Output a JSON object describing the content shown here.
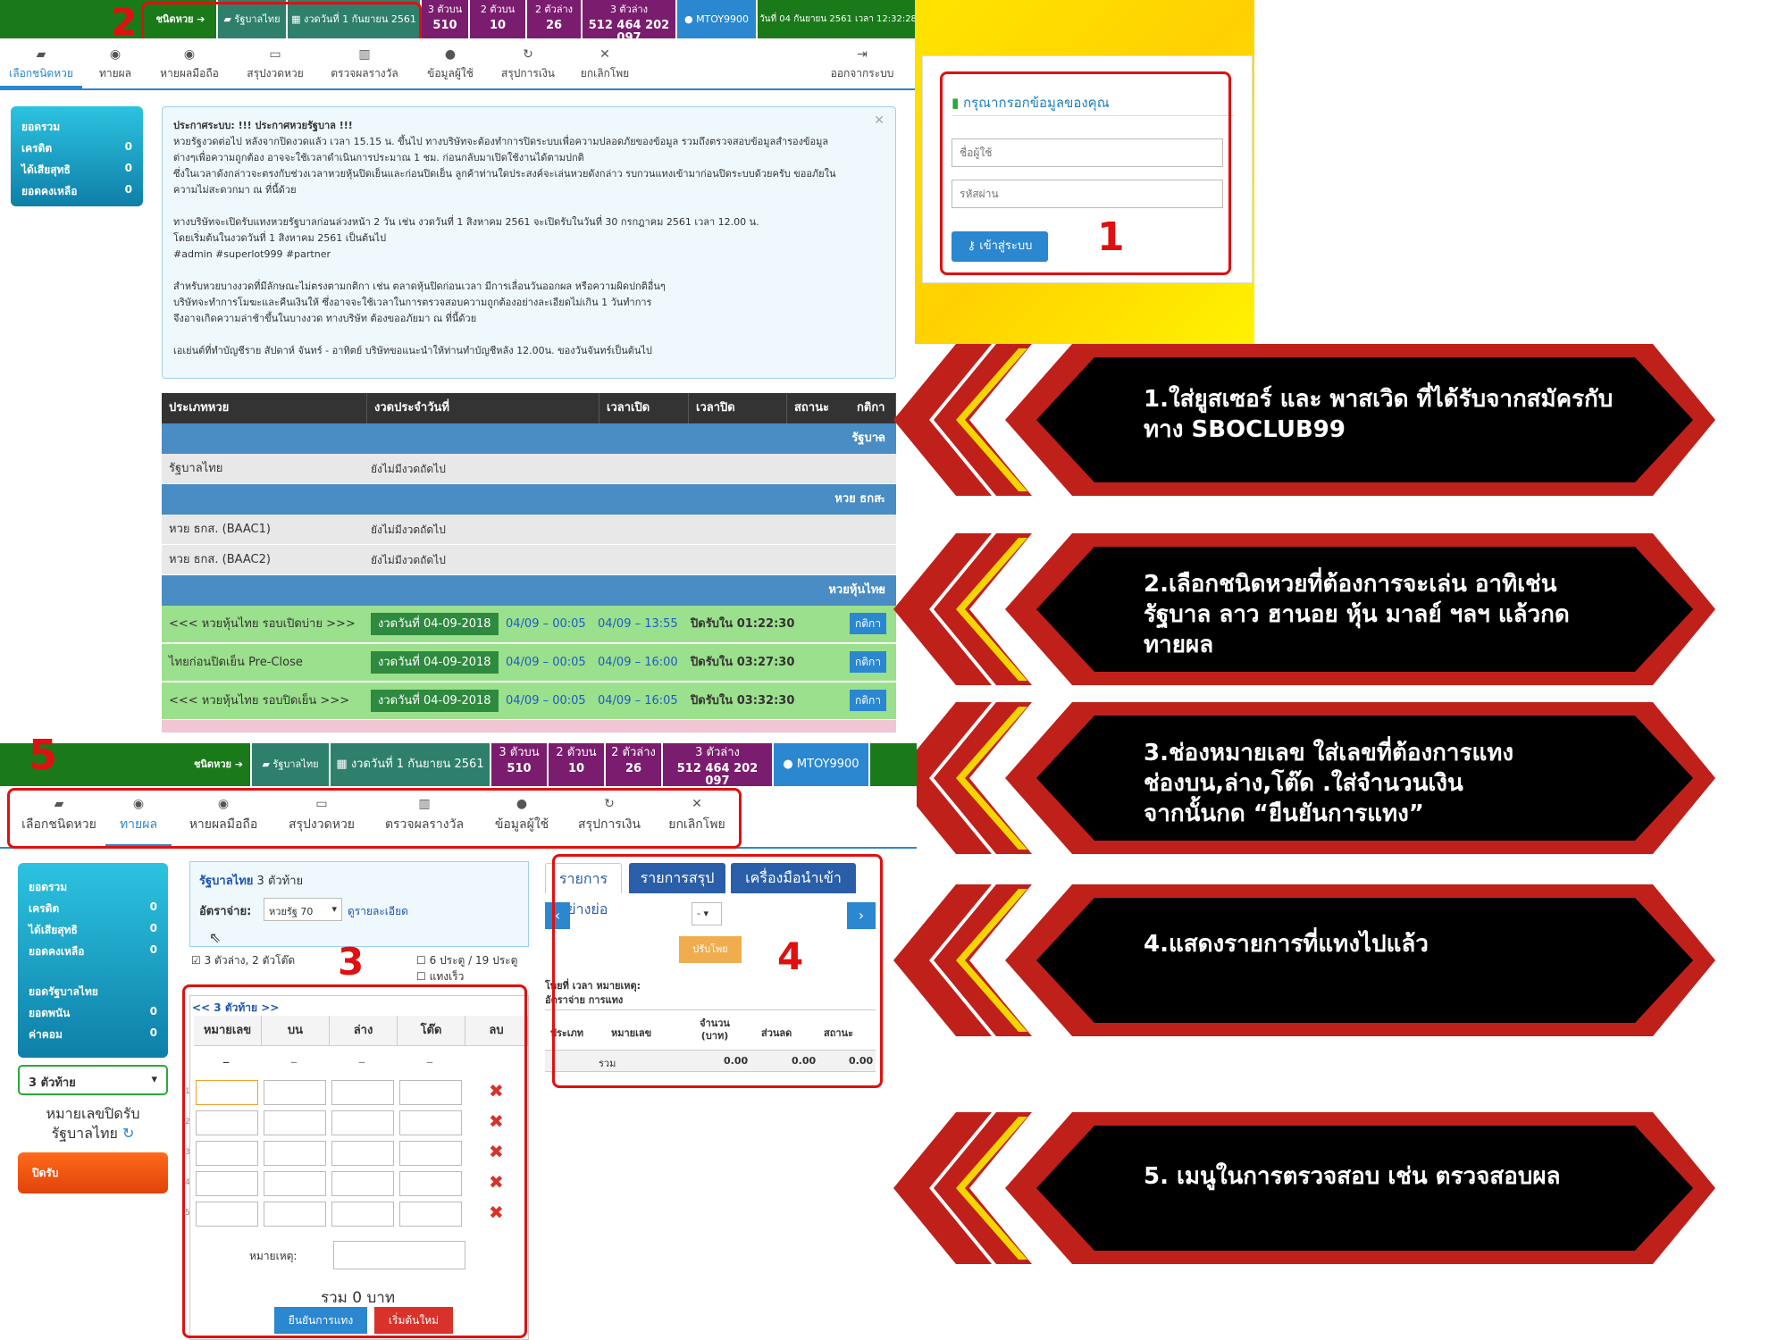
{
  "topbar": {
    "lottery_type": "ชนิดหวย ➔",
    "lottery_name": "รัฐบาลไทย",
    "draw": "งวดวันที่ 1 กันยายน 2561",
    "stats": [
      {
        "label": "3 ตัวบน",
        "value": "510"
      },
      {
        "label": "2 ตัวบน",
        "value": "10"
      },
      {
        "label": "2 ตัวล่าง",
        "value": "26"
      },
      {
        "label": "3 ตัวล่าง",
        "value": "512 464 202 097"
      }
    ],
    "user": "MTOY9900",
    "datetime": "วันที่ 04 กันยายน 2561 เวลา 12:32:28"
  },
  "nav": {
    "items": [
      "เลือกชนิดหวย",
      "ทายผล",
      "หายผลมือถือ",
      "สรุปงวดหวย",
      "ตรวจผลรางวัล",
      "ข้อมูลผู้ใช้",
      "สรุปการเงิน",
      "ยกเลิกโพย"
    ],
    "logout": "ออกจากระบบ"
  },
  "balance": {
    "title": "ยอดรวม",
    "rows": [
      {
        "label": "เครดิต",
        "value": "0"
      },
      {
        "label": "ได้เสียสุทธิ",
        "value": "0"
      },
      {
        "label": "ยอดคงเหลือ",
        "value": "0"
      }
    ]
  },
  "announce": {
    "lines": [
      "ประกาศระบบ: !!! ประกาศหวยรัฐบาล !!!",
      "หวยรัฐงวดต่อไป หลังจากปิดงวดแล้ว เวลา 15.15 น. ขึ้นไป ทางบริษัทจะต้องทำการปิดระบบเพื่อความปลอดภัยของข้อมูล รวมถึงตรวจสอบข้อมูลสำรองข้อมูล",
      "ต่างๆเพื่อความถูกต้อง อาจจะใช้เวลาดำเนินการประมาณ 1 ชม. ก่อนกลับมาเปิดใช้งานได้ตามปกติ",
      "ซึ่งในเวลาดังกล่าวจะตรงกับช่วงเวลาหวยหุ้นปิดเย็นและก่อนปิดเย็น ลูกค้าท่านใดประสงค์จะเล่นหวยดังกล่าว รบกวนแทงเข้ามาก่อนปิดระบบด้วยครับ ขออภัยใน",
      "ความไม่สะดวกมา ณ ที่นี้ด้วย",
      "",
      "ทางบริษัทจะเปิดรับแทงหวยรัฐบาลก่อนล่วงหน้า 2 วัน เช่น งวดวันที่ 1 สิงหาคม 2561 จะเปิดรับในวันที่ 30 กรกฎาคม 2561 เวลา 12.00 น.",
      "โดยเริ่มต้นในงวดวันที่ 1 สิงหาคม 2561 เป็นต้นไป",
      "#admin #superlot999 #partner",
      "",
      "สำหรับหวยบางงวดที่มีลักษณะไม่ตรงตามกติกา เช่น ตลาดหุ้นปิดก่อนเวลา มีการเลื่อนวันออกผล หรือความผิดปกติอื่นๆ",
      "บริษัทจะทำการโมฆะและคืนเงินให้ ซึ่งอาจจะใช้เวลาในการตรวจสอบความถูกต้องอย่างละเอียดไม่เกิน 1 วันทำการ",
      "จึงอาจเกิดความล่าช้าขึ้นในบางงวด ทางบริษัท ต้องขออภัยมา ณ ที่นี้ด้วย",
      "",
      "เอเย่นต์ที่ทำบัญชีราย สัปดาห์ จันทร์ - อาทิตย์ บริษัทขอแนะนำให้ท่านทำบัญชีหลัง 12.00น. ของวันจันทร์เป็นต้นไป"
    ]
  },
  "lotto_table": {
    "headers": [
      "ประเภทหวย",
      "งวดประจำวันที่",
      "เวลาเปิด",
      "เวลาปิด",
      "สถานะ",
      "กติกา"
    ],
    "groups": [
      {
        "name": "รัฐบาล",
        "rows": [
          {
            "name": "รัฐบาลไทย",
            "status": "ยังไม่มีงวดถัดไป"
          }
        ]
      },
      {
        "name": "หวย ธกส.",
        "rows": [
          {
            "name": "หวย ธกส. (BAAC1)",
            "status": "ยังไม่มีงวดถัดไป"
          },
          {
            "name": "หวย ธกส. (BAAC2)",
            "status": "ยังไม่มีงวดถัดไป"
          }
        ]
      },
      {
        "name": "หวยหุ้นไทย"
      }
    ],
    "stock_rows": [
      {
        "name": "<<< หวยหุ้นไทย รอบเปิดบ่าย >>>",
        "draw": "งวดวันที่ 04-09-2018",
        "open": "04/09 – 00:05",
        "close": "04/09 – 13:55",
        "status": "ปิดรับใน 01:22:30",
        "rule": "กติกา"
      },
      {
        "name": "ไทยก่อนปิดเย็น Pre-Close",
        "draw": "งวดวันที่ 04-09-2018",
        "open": "04/09 – 00:05",
        "close": "04/09 – 16:00",
        "status": "ปิดรับใน 03:27:30",
        "rule": "กติกา"
      },
      {
        "name": "<<< หวยหุ้นไทย รอบปิดเย็น >>>",
        "draw": "งวดวันที่ 04-09-2018",
        "open": "04/09 – 00:05",
        "close": "04/09 – 16:05",
        "status": "ปิดรับใน 03:32:30",
        "rule": "กติกา"
      }
    ]
  },
  "login": {
    "title": "กรุณากรอกข้อมูลของคุณ",
    "username_placeholder": "ชื่อผู้ใช้",
    "password_placeholder": "รหัสผ่าน",
    "submit": "เข้าสู่ระบบ"
  },
  "markers": [
    "1",
    "2",
    "3",
    "4",
    "5"
  ],
  "callouts": [
    "1.ใส่ยูสเซอร์ และ พาสเวิด ที่ได้รับจากสมัครกับ\nทาง SBOCLUB99",
    "2.เลือกชนิดหวยที่ต้องการจะเล่น อาทิเช่น\nรัฐบาล ลาว ฮานอย หุ้น มาลย์ ฯลฯ แล้วกด\nทายผล",
    "3.ช่องหมายเลข ใส่เลขที่ต้องการแทง\n  ช่องบน,ล่าง,โต๊ด .ใส่จำนวนเงิน\nจากนั้นกด “ยืนยันการแทง”",
    "4.แสดงรายการที่แทงไปแล้ว",
    "5. เมนูในการตรวจสอบ เช่น ตรวจสอบผล"
  ],
  "bet": {
    "header_title": "รัฐบาลไทย",
    "header_sub": "3 ตัวท้าย",
    "rate_label": "อัตราจ่าย:",
    "rate_value": "หวยรัฐ 70",
    "rate_link": "ดูรายละเอียด",
    "opt1": "3 ตัวล่าง, 2 ตัวโต๊ด",
    "opt2": "6 ประตู / 19 ประตู",
    "opt3": "แทงเร็ว",
    "link": "<< 3 ตัวท้าย >>",
    "cols": [
      "หมายเลข",
      "บน",
      "ล่าง",
      "โต๊ด",
      "ลบ"
    ],
    "dash": "–",
    "row_nums": [
      "1",
      "2",
      "3",
      "4",
      "5"
    ],
    "note_label": "หมายเหตุ:",
    "total": "รวม 0 บาท",
    "confirm": "ยืนยันการแทง",
    "reset": "เริ่มต้นใหม่"
  },
  "side2": {
    "title": "ยอดรวม",
    "rows": [
      {
        "label": "เครดิต",
        "value": "0"
      },
      {
        "label": "ได้เสียสุทธิ",
        "value": "0"
      },
      {
        "label": "ยอดคงเหลือ",
        "value": "0"
      }
    ],
    "title2": "ยอดรัฐบาลไทย",
    "rows2": [
      {
        "label": "ยอดพนัน",
        "value": "0"
      },
      {
        "label": "ค่าคอม",
        "value": "0"
      }
    ],
    "select": "3 ตัวท้าย",
    "closed_label": "หมายเลขปิดรับ",
    "closed_sub": "รัฐบาลไทย",
    "closed_btn": "ปิดรับ"
  },
  "history": {
    "tabs": [
      "รายการอย่างย่อ",
      "รายการสรุปรวม",
      "เครื่องมือนำเข้าข้อมูล"
    ],
    "select": "-",
    "btn": "ปรับโพย",
    "line1": "โพยที่ เวลา หมายเหตุ:",
    "line2": "อัตราจ่าย การแทง",
    "cols": [
      "ประเภท",
      "หมายเลข",
      "จำนวน (บาท)",
      "ส่วนลด",
      "สถานะ"
    ],
    "sum_label": "รวม",
    "sums": [
      "0.00",
      "0.00",
      "0.00"
    ]
  }
}
